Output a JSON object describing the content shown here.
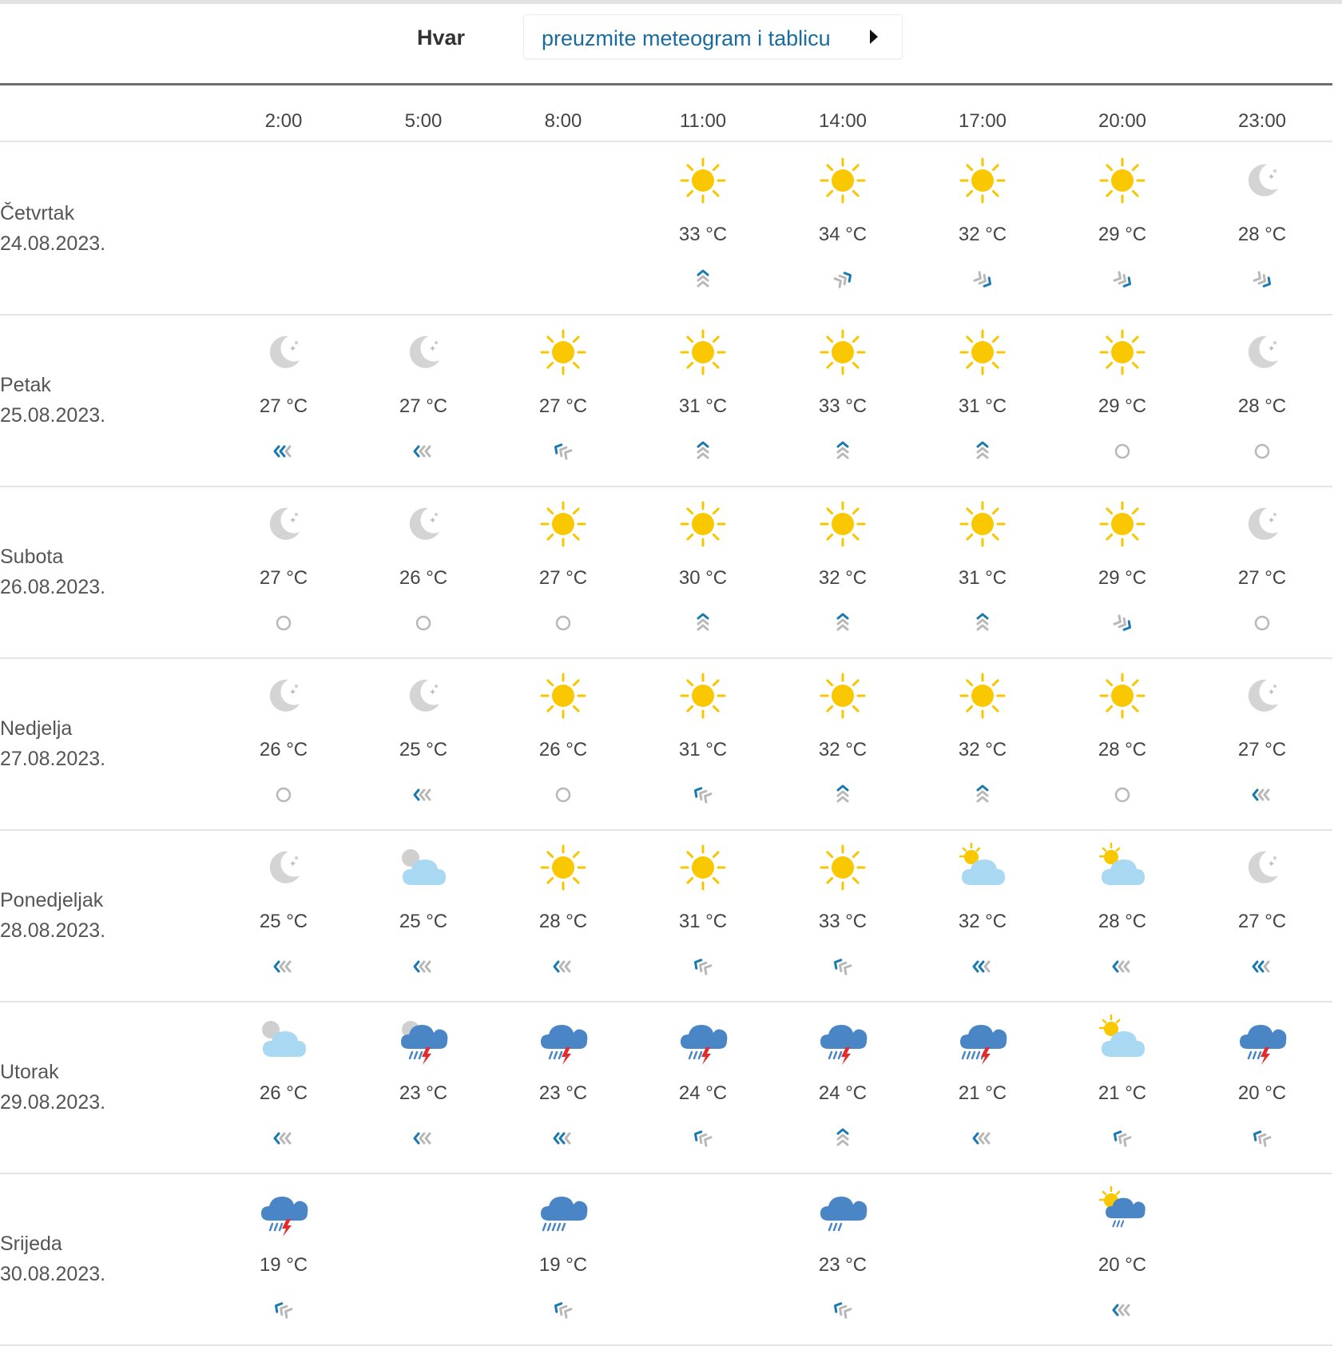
{
  "location": "Hvar",
  "download_link": "preuzmite meteogram i tablicu",
  "hours": [
    "2:00",
    "5:00",
    "8:00",
    "11:00",
    "14:00",
    "17:00",
    "20:00",
    "23:00"
  ],
  "days": [
    {
      "day": "Četvrtak",
      "date": "24.08.2023.",
      "cells": [
        null,
        null,
        null,
        {
          "icon": "sun-icon",
          "temp": "33 °C",
          "wind": "wind-north-icon"
        },
        {
          "icon": "sun-icon",
          "temp": "34 °C",
          "wind": "wind-northeast-icon"
        },
        {
          "icon": "sun-icon",
          "temp": "32 °C",
          "wind": "wind-southeast-icon"
        },
        {
          "icon": "sun-icon",
          "temp": "29 °C",
          "wind": "wind-southeast-icon"
        },
        {
          "icon": "moon-icon",
          "temp": "28 °C",
          "wind": "wind-southeast-icon"
        }
      ]
    },
    {
      "day": "Petak",
      "date": "25.08.2023.",
      "cells": [
        {
          "icon": "moon-icon",
          "temp": "27 °C",
          "wind": "wind-west-strong-icon"
        },
        {
          "icon": "moon-icon",
          "temp": "27 °C",
          "wind": "wind-west-icon"
        },
        {
          "icon": "sun-icon",
          "temp": "27 °C",
          "wind": "wind-northwest-icon"
        },
        {
          "icon": "sun-icon",
          "temp": "31 °C",
          "wind": "wind-north-icon"
        },
        {
          "icon": "sun-icon",
          "temp": "33 °C",
          "wind": "wind-north-icon"
        },
        {
          "icon": "sun-icon",
          "temp": "31 °C",
          "wind": "wind-north-icon"
        },
        {
          "icon": "sun-icon",
          "temp": "29 °C",
          "wind": "calm-icon"
        },
        {
          "icon": "moon-icon",
          "temp": "28 °C",
          "wind": "calm-icon"
        }
      ]
    },
    {
      "day": "Subota",
      "date": "26.08.2023.",
      "cells": [
        {
          "icon": "moon-icon",
          "temp": "27 °C",
          "wind": "calm-icon"
        },
        {
          "icon": "moon-icon",
          "temp": "26 °C",
          "wind": "calm-icon"
        },
        {
          "icon": "sun-icon",
          "temp": "27 °C",
          "wind": "calm-icon"
        },
        {
          "icon": "sun-icon",
          "temp": "30 °C",
          "wind": "wind-north-icon"
        },
        {
          "icon": "sun-icon",
          "temp": "32 °C",
          "wind": "wind-north-icon"
        },
        {
          "icon": "sun-icon",
          "temp": "31 °C",
          "wind": "wind-north-icon"
        },
        {
          "icon": "sun-icon",
          "temp": "29 °C",
          "wind": "wind-southeast-icon"
        },
        {
          "icon": "moon-icon",
          "temp": "27 °C",
          "wind": "calm-icon"
        }
      ]
    },
    {
      "day": "Nedjelja",
      "date": "27.08.2023.",
      "cells": [
        {
          "icon": "moon-icon",
          "temp": "26 °C",
          "wind": "calm-icon"
        },
        {
          "icon": "moon-icon",
          "temp": "25 °C",
          "wind": "wind-west-icon"
        },
        {
          "icon": "sun-icon",
          "temp": "26 °C",
          "wind": "calm-icon"
        },
        {
          "icon": "sun-icon",
          "temp": "31 °C",
          "wind": "wind-northwest-icon"
        },
        {
          "icon": "sun-icon",
          "temp": "32 °C",
          "wind": "wind-north-icon"
        },
        {
          "icon": "sun-icon",
          "temp": "32 °C",
          "wind": "wind-north-icon"
        },
        {
          "icon": "sun-icon",
          "temp": "28 °C",
          "wind": "calm-icon"
        },
        {
          "icon": "moon-icon",
          "temp": "27 °C",
          "wind": "wind-west-icon"
        }
      ]
    },
    {
      "day": "Ponedjeljak",
      "date": "28.08.2023.",
      "cells": [
        {
          "icon": "moon-icon",
          "temp": "25 °C",
          "wind": "wind-west-icon"
        },
        {
          "icon": "moon-cloud-icon",
          "temp": "25 °C",
          "wind": "wind-west-icon"
        },
        {
          "icon": "sun-icon",
          "temp": "28 °C",
          "wind": "wind-west-icon"
        },
        {
          "icon": "sun-icon",
          "temp": "31 °C",
          "wind": "wind-northwest-icon"
        },
        {
          "icon": "sun-icon",
          "temp": "33 °C",
          "wind": "wind-northwest-icon"
        },
        {
          "icon": "sun-cloud-icon",
          "temp": "32 °C",
          "wind": "wind-west-strong-icon"
        },
        {
          "icon": "sun-cloud-icon",
          "temp": "28 °C",
          "wind": "wind-west-icon"
        },
        {
          "icon": "moon-icon",
          "temp": "27 °C",
          "wind": "wind-west-strong-icon"
        }
      ]
    },
    {
      "day": "Utorak",
      "date": "29.08.2023.",
      "cells": [
        {
          "icon": "moon-cloud-icon",
          "temp": "26 °C",
          "wind": "wind-west-icon"
        },
        {
          "icon": "moon-thunderstorm-icon",
          "temp": "23 °C",
          "wind": "wind-west-icon"
        },
        {
          "icon": "thunderstorm-icon",
          "temp": "23 °C",
          "wind": "wind-west-strong-icon"
        },
        {
          "icon": "thunderstorm-icon",
          "temp": "24 °C",
          "wind": "wind-northwest-icon"
        },
        {
          "icon": "thunderstorm-icon",
          "temp": "24 °C",
          "wind": "wind-north-icon"
        },
        {
          "icon": "heavy-thunderstorm-icon",
          "temp": "21 °C",
          "wind": "wind-west-icon"
        },
        {
          "icon": "sun-cloud-icon",
          "temp": "21 °C",
          "wind": "wind-northwest-icon"
        },
        {
          "icon": "thunderstorm-icon",
          "temp": "20 °C",
          "wind": "wind-northwest-icon"
        }
      ]
    },
    {
      "day": "Srijeda",
      "date": "30.08.2023.",
      "cells": [
        {
          "icon": "thunderstorm-icon",
          "temp": "19 °C",
          "wind": "wind-northwest-icon"
        },
        null,
        {
          "icon": "heavy-rain-icon",
          "temp": "19 °C",
          "wind": "wind-northwest-icon"
        },
        null,
        {
          "icon": "rain-icon",
          "temp": "23 °C",
          "wind": "wind-northwest-icon"
        },
        null,
        {
          "icon": "sun-rain-icon",
          "temp": "20 °C",
          "wind": "wind-west-icon"
        },
        null
      ]
    }
  ]
}
